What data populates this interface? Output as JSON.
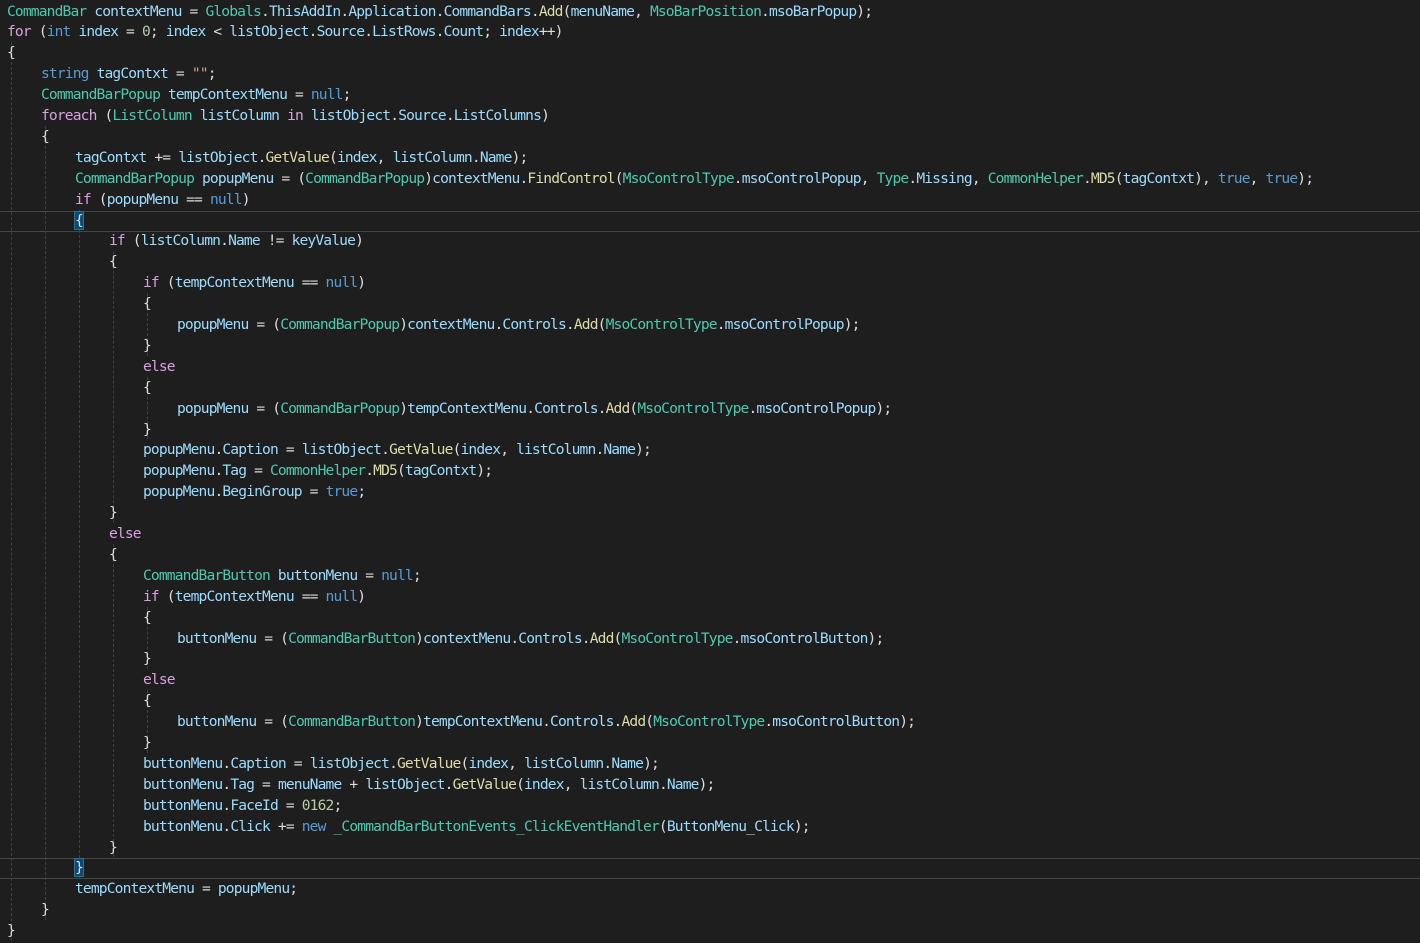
{
  "editor": {
    "background": "#1e1e1e",
    "language": "C#",
    "palette": {
      "type": "#4ec9b0",
      "keyword": "#569cd6",
      "control": "#d8a0df",
      "variable": "#9cdcfe",
      "method": "#dcdcaa",
      "string": "#d69d85",
      "number": "#b5cea8",
      "operator": "#b4b4b4",
      "plain": "#dcdcdc"
    },
    "lines": [
      {
        "i": 0,
        "t": [
          [
            "CommandBar",
            "type"
          ],
          " ",
          [
            "contextMenu",
            "var"
          ],
          " = ",
          [
            "Globals",
            "type"
          ],
          ".",
          [
            "ThisAddIn",
            "var"
          ],
          ".",
          [
            "Application",
            "var"
          ],
          ".",
          [
            "CommandBars",
            "var"
          ],
          ".",
          [
            "Add",
            "fn"
          ],
          "(",
          [
            "menuName",
            "var"
          ],
          ", ",
          [
            "MsoBarPosition",
            "type"
          ],
          ".",
          [
            "msoBarPopup",
            "var"
          ],
          ");"
        ]
      },
      {
        "i": 0,
        "t": [
          [
            "for",
            "ctl"
          ],
          " (",
          [
            "int",
            "kw"
          ],
          " ",
          [
            "index",
            "var"
          ],
          " = ",
          [
            "0",
            "num"
          ],
          "; ",
          [
            "index",
            "var"
          ],
          " < ",
          [
            "listObject",
            "var"
          ],
          ".",
          [
            "Source",
            "var"
          ],
          ".",
          [
            "ListRows",
            "var"
          ],
          ".",
          [
            "Count",
            "var"
          ],
          "; ",
          [
            "index",
            "var"
          ],
          "++)"
        ]
      },
      {
        "i": 0,
        "t": [
          "{"
        ]
      },
      {
        "i": 1,
        "t": [
          [
            "string",
            "kw"
          ],
          " ",
          [
            "tagContxt",
            "var"
          ],
          " = ",
          [
            "\"\"",
            "str"
          ],
          ";"
        ]
      },
      {
        "i": 1,
        "t": [
          [
            "CommandBarPopup",
            "type"
          ],
          " ",
          [
            "tempContextMenu",
            "var"
          ],
          " = ",
          [
            "null",
            "kw"
          ],
          ";"
        ]
      },
      {
        "i": 1,
        "t": [
          [
            "foreach",
            "ctl"
          ],
          " (",
          [
            "ListColumn",
            "type"
          ],
          " ",
          [
            "listColumn",
            "var"
          ],
          " ",
          [
            "in",
            "ctl"
          ],
          " ",
          [
            "listObject",
            "var"
          ],
          ".",
          [
            "Source",
            "var"
          ],
          ".",
          [
            "ListColumns",
            "var"
          ],
          ")"
        ]
      },
      {
        "i": 1,
        "t": [
          "{"
        ]
      },
      {
        "i": 2,
        "t": [
          [
            "tagContxt",
            "var"
          ],
          " += ",
          [
            "listObject",
            "var"
          ],
          ".",
          [
            "GetValue",
            "fn"
          ],
          "(",
          [
            "index",
            "var"
          ],
          ", ",
          [
            "listColumn",
            "var"
          ],
          ".",
          [
            "Name",
            "var"
          ],
          ");"
        ]
      },
      {
        "i": 2,
        "t": [
          [
            "CommandBarPopup",
            "type"
          ],
          " ",
          [
            "popupMenu",
            "var"
          ],
          " = (",
          [
            "CommandBarPopup",
            "type"
          ],
          ")",
          [
            "contextMenu",
            "var"
          ],
          ".",
          [
            "FindControl",
            "fn"
          ],
          "(",
          [
            "MsoControlType",
            "type"
          ],
          ".",
          [
            "msoControlPopup",
            "var"
          ],
          ", ",
          [
            "Type",
            "type"
          ],
          ".",
          [
            "Missing",
            "var"
          ],
          ", ",
          [
            "CommonHelper",
            "type"
          ],
          ".",
          [
            "MD5",
            "fn"
          ],
          "(",
          [
            "tagContxt",
            "var"
          ],
          "), ",
          [
            "true",
            "kw"
          ],
          ", ",
          [
            "true",
            "kw"
          ],
          ");"
        ]
      },
      {
        "i": 2,
        "t": [
          [
            "if",
            "ctl"
          ],
          " (",
          [
            "popupMenu",
            "var"
          ],
          " == ",
          [
            "null",
            "kw"
          ],
          ")"
        ]
      },
      {
        "i": 2,
        "hl": true,
        "t": [
          [
            "{",
            "match"
          ]
        ]
      },
      {
        "i": 3,
        "t": [
          [
            "if",
            "ctl"
          ],
          " (",
          [
            "listColumn",
            "var"
          ],
          ".",
          [
            "Name",
            "var"
          ],
          " != ",
          [
            "keyValue",
            "var"
          ],
          ")"
        ]
      },
      {
        "i": 3,
        "t": [
          "{"
        ]
      },
      {
        "i": 4,
        "t": [
          [
            "if",
            "ctl"
          ],
          " (",
          [
            "tempContextMenu",
            "var"
          ],
          " == ",
          [
            "null",
            "kw"
          ],
          ")"
        ]
      },
      {
        "i": 4,
        "t": [
          "{"
        ]
      },
      {
        "i": 5,
        "t": [
          [
            "popupMenu",
            "var"
          ],
          " = (",
          [
            "CommandBarPopup",
            "type"
          ],
          ")",
          [
            "contextMenu",
            "var"
          ],
          ".",
          [
            "Controls",
            "var"
          ],
          ".",
          [
            "Add",
            "fn"
          ],
          "(",
          [
            "MsoControlType",
            "type"
          ],
          ".",
          [
            "msoControlPopup",
            "var"
          ],
          ");"
        ]
      },
      {
        "i": 4,
        "t": [
          "}"
        ]
      },
      {
        "i": 4,
        "t": [
          [
            "else",
            "ctl"
          ]
        ]
      },
      {
        "i": 4,
        "t": [
          "{"
        ]
      },
      {
        "i": 5,
        "t": [
          [
            "popupMenu",
            "var"
          ],
          " = (",
          [
            "CommandBarPopup",
            "type"
          ],
          ")",
          [
            "tempContextMenu",
            "var"
          ],
          ".",
          [
            "Controls",
            "var"
          ],
          ".",
          [
            "Add",
            "fn"
          ],
          "(",
          [
            "MsoControlType",
            "type"
          ],
          ".",
          [
            "msoControlPopup",
            "var"
          ],
          ");"
        ]
      },
      {
        "i": 4,
        "t": [
          "}"
        ]
      },
      {
        "i": 4,
        "t": [
          [
            "popupMenu",
            "var"
          ],
          ".",
          [
            "Caption",
            "var"
          ],
          " = ",
          [
            "listObject",
            "var"
          ],
          ".",
          [
            "GetValue",
            "fn"
          ],
          "(",
          [
            "index",
            "var"
          ],
          ", ",
          [
            "listColumn",
            "var"
          ],
          ".",
          [
            "Name",
            "var"
          ],
          ");"
        ]
      },
      {
        "i": 4,
        "t": [
          [
            "popupMenu",
            "var"
          ],
          ".",
          [
            "Tag",
            "var"
          ],
          " = ",
          [
            "CommonHelper",
            "type"
          ],
          ".",
          [
            "MD5",
            "fn"
          ],
          "(",
          [
            "tagContxt",
            "var"
          ],
          ");"
        ]
      },
      {
        "i": 4,
        "t": [
          [
            "popupMenu",
            "var"
          ],
          ".",
          [
            "BeginGroup",
            "var"
          ],
          " = ",
          [
            "true",
            "kw"
          ],
          ";"
        ]
      },
      {
        "i": 3,
        "t": [
          "}"
        ]
      },
      {
        "i": 3,
        "t": [
          [
            "else",
            "ctl"
          ]
        ]
      },
      {
        "i": 3,
        "t": [
          "{"
        ]
      },
      {
        "i": 4,
        "t": [
          [
            "CommandBarButton",
            "type"
          ],
          " ",
          [
            "buttonMenu",
            "var"
          ],
          " = ",
          [
            "null",
            "kw"
          ],
          ";"
        ]
      },
      {
        "i": 4,
        "t": [
          [
            "if",
            "ctl"
          ],
          " (",
          [
            "tempContextMenu",
            "var"
          ],
          " == ",
          [
            "null",
            "kw"
          ],
          ")"
        ]
      },
      {
        "i": 4,
        "t": [
          "{"
        ]
      },
      {
        "i": 5,
        "t": [
          [
            "buttonMenu",
            "var"
          ],
          " = (",
          [
            "CommandBarButton",
            "type"
          ],
          ")",
          [
            "contextMenu",
            "var"
          ],
          ".",
          [
            "Controls",
            "var"
          ],
          ".",
          [
            "Add",
            "fn"
          ],
          "(",
          [
            "MsoControlType",
            "type"
          ],
          ".",
          [
            "msoControlButton",
            "var"
          ],
          ");"
        ]
      },
      {
        "i": 4,
        "t": [
          "}"
        ]
      },
      {
        "i": 4,
        "t": [
          [
            "else",
            "ctl"
          ]
        ]
      },
      {
        "i": 4,
        "t": [
          "{"
        ]
      },
      {
        "i": 5,
        "t": [
          [
            "buttonMenu",
            "var"
          ],
          " = (",
          [
            "CommandBarButton",
            "type"
          ],
          ")",
          [
            "tempContextMenu",
            "var"
          ],
          ".",
          [
            "Controls",
            "var"
          ],
          ".",
          [
            "Add",
            "fn"
          ],
          "(",
          [
            "MsoControlType",
            "type"
          ],
          ".",
          [
            "msoControlButton",
            "var"
          ],
          ");"
        ]
      },
      {
        "i": 4,
        "t": [
          "}"
        ]
      },
      {
        "i": 4,
        "t": [
          [
            "buttonMenu",
            "var"
          ],
          ".",
          [
            "Caption",
            "var"
          ],
          " = ",
          [
            "listObject",
            "var"
          ],
          ".",
          [
            "GetValue",
            "fn"
          ],
          "(",
          [
            "index",
            "var"
          ],
          ", ",
          [
            "listColumn",
            "var"
          ],
          ".",
          [
            "Name",
            "var"
          ],
          ");"
        ]
      },
      {
        "i": 4,
        "t": [
          [
            "buttonMenu",
            "var"
          ],
          ".",
          [
            "Tag",
            "var"
          ],
          " = ",
          [
            "menuName",
            "var"
          ],
          " + ",
          [
            "listObject",
            "var"
          ],
          ".",
          [
            "GetValue",
            "fn"
          ],
          "(",
          [
            "index",
            "var"
          ],
          ", ",
          [
            "listColumn",
            "var"
          ],
          ".",
          [
            "Name",
            "var"
          ],
          ");"
        ]
      },
      {
        "i": 4,
        "t": [
          [
            "buttonMenu",
            "var"
          ],
          ".",
          [
            "FaceId",
            "var"
          ],
          " = ",
          [
            "0162",
            "num"
          ],
          ";"
        ]
      },
      {
        "i": 4,
        "t": [
          [
            "buttonMenu",
            "var"
          ],
          ".",
          [
            "Click",
            "var"
          ],
          " += ",
          [
            "new",
            "kw"
          ],
          " ",
          [
            "_CommandBarButtonEvents_ClickEventHandler",
            "type"
          ],
          "(",
          [
            "ButtonMenu_Click",
            "var"
          ],
          ");"
        ]
      },
      {
        "i": 3,
        "t": [
          "}"
        ]
      },
      {
        "i": 2,
        "hl": true,
        "t": [
          [
            "}",
            "match"
          ]
        ]
      },
      {
        "i": 2,
        "t": [
          [
            "tempContextMenu",
            "var"
          ],
          " = ",
          [
            "popupMenu",
            "var"
          ],
          ";"
        ]
      },
      {
        "i": 1,
        "t": [
          "}"
        ]
      },
      {
        "i": 0,
        "t": [
          "}"
        ]
      }
    ],
    "guides": [
      {
        "level": 0,
        "from": 2,
        "to": 44
      },
      {
        "level": 1,
        "from": 6,
        "to": 43
      },
      {
        "level": 2,
        "from": 10,
        "to": 41
      },
      {
        "level": 3,
        "from": 12,
        "to": 24
      },
      {
        "level": 4,
        "from": 14,
        "to": 16
      },
      {
        "level": 4,
        "from": 18,
        "to": 20
      },
      {
        "level": 3,
        "from": 26,
        "to": 40
      },
      {
        "level": 4,
        "from": 29,
        "to": 31
      },
      {
        "level": 4,
        "from": 33,
        "to": 35
      }
    ]
  }
}
